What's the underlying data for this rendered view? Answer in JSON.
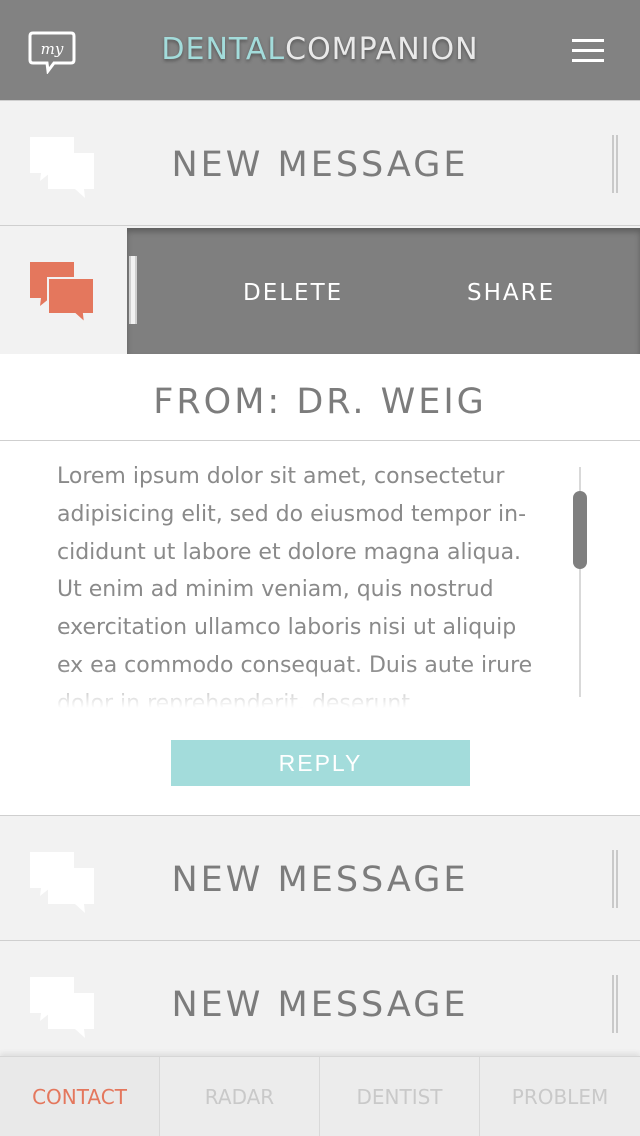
{
  "header": {
    "logo_text": "my",
    "title_part1": "DENTAL",
    "title_part2": "COMPANION",
    "menu_icon": "hamburger-icon",
    "colors": {
      "bar": "#828282",
      "accent": "#a3dcdb"
    }
  },
  "messages": [
    {
      "label": "NEW MESSAGE",
      "icon": "chat-bubbles-icon"
    },
    {
      "label": "NEW MESSAGE",
      "icon": "chat-bubbles-icon"
    },
    {
      "label": "NEW MESSAGE",
      "icon": "chat-bubbles-icon"
    }
  ],
  "selected": {
    "icon": "chat-bubbles-icon",
    "icon_color": "#e4775d",
    "delete_label": "DELETE",
    "share_label": "SHARE"
  },
  "detail": {
    "from": "FROM: DR. WEIG",
    "body": "Lorem ipsum dolor sit amet, consectetur adipisicing elit, sed do eiusmod tempor in-cididunt ut labore et dolore magna aliqua. Ut enim ad minim veniam, quis nostrud exercitation ullamco laboris nisi ut aliquip ex ea commodo consequat. Duis aute irure dolor in reprehenderit, deserunt",
    "reply_label": "REPLY"
  },
  "nav": {
    "items": [
      {
        "label": "CONTACT",
        "active": true
      },
      {
        "label": "RADAR",
        "active": false
      },
      {
        "label": "DENTIST",
        "active": false
      },
      {
        "label": "PROBLEM",
        "active": false
      }
    ],
    "active_color": "#e4775d"
  }
}
